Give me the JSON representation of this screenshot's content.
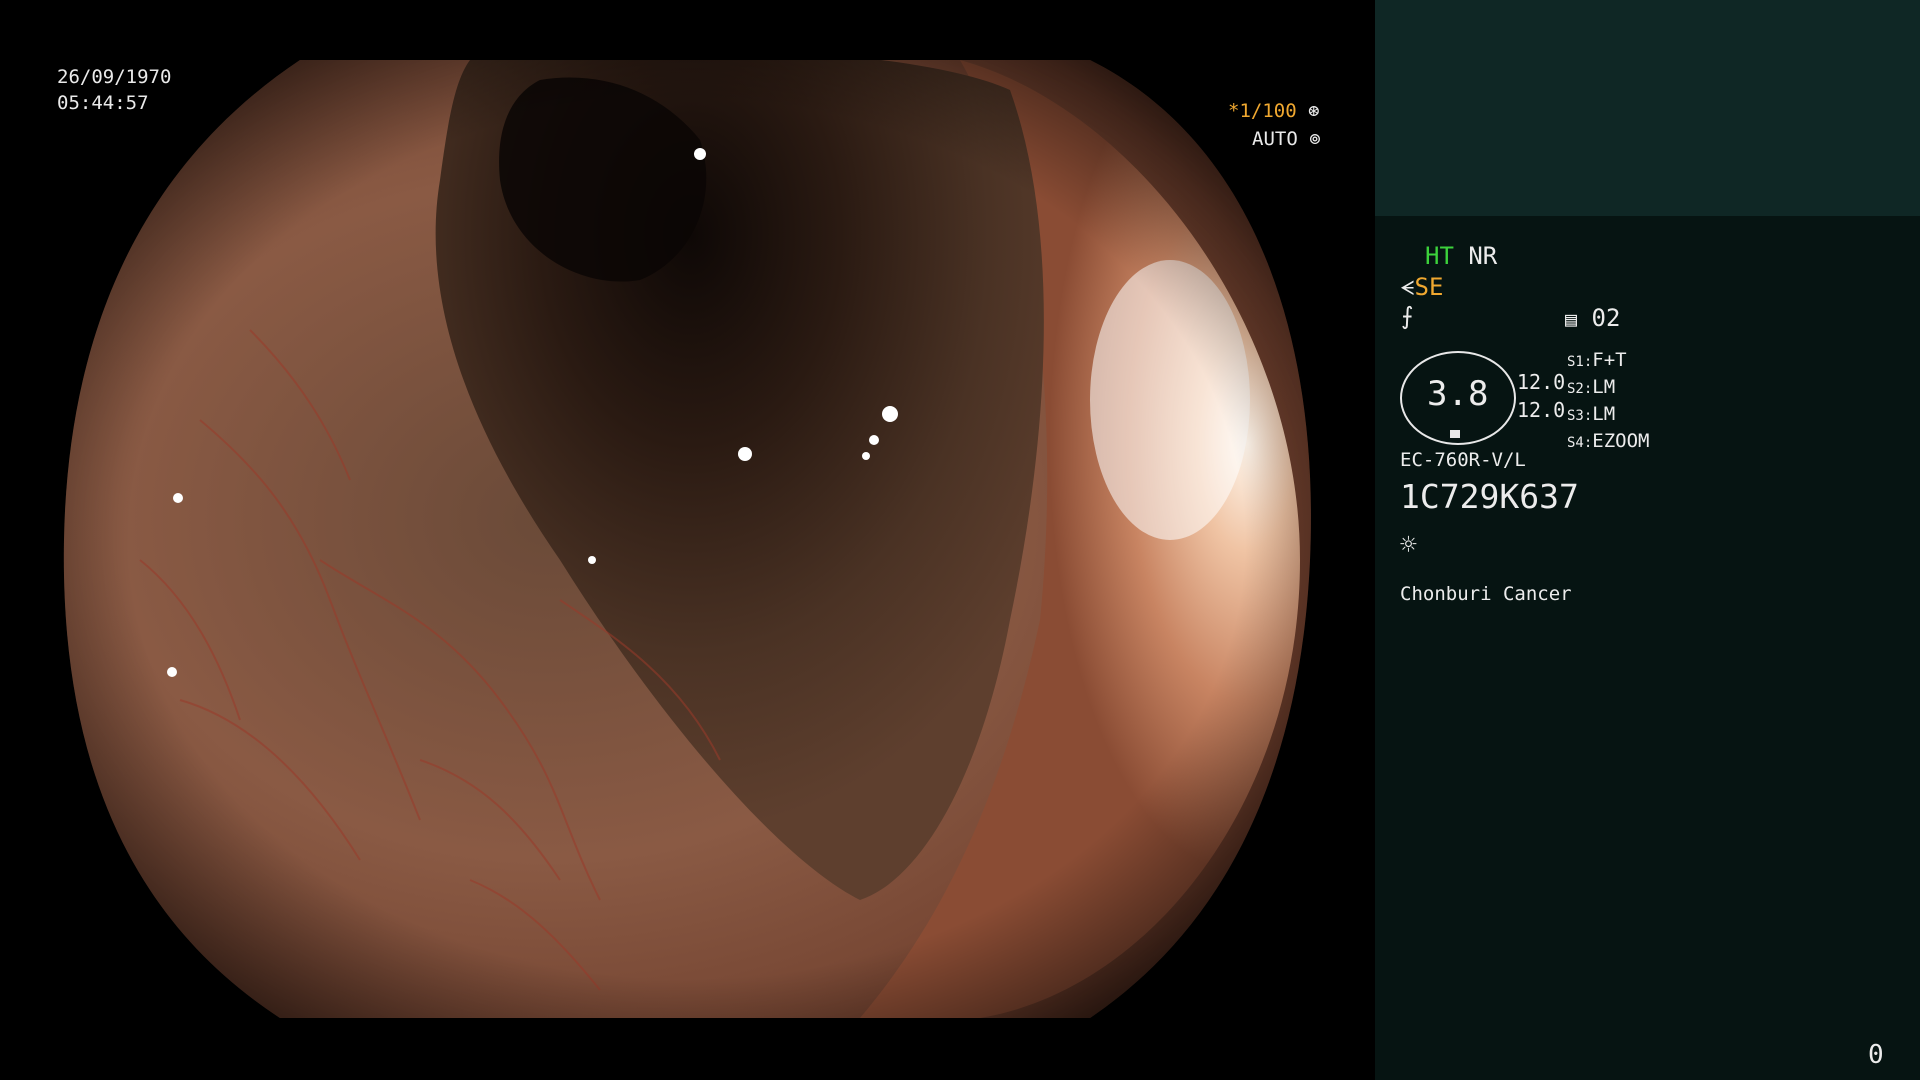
{
  "overlay": {
    "date": "26/09/1970",
    "time": "05:44:57",
    "shutter": "*1/100",
    "iris": "AUTO"
  },
  "panel": {
    "ht": "HT",
    "nr": "NR",
    "se": "SE",
    "preset": "02",
    "zoom_value": "3.8",
    "val_top": "12.0",
    "val_bottom": "12.0",
    "switches": [
      {
        "key": "S1:",
        "value": "F+T"
      },
      {
        "key": "S2:",
        "value": "LM"
      },
      {
        "key": "S3:",
        "value": "LM"
      },
      {
        "key": "S4:",
        "value": "EZOOM"
      }
    ],
    "scope_model": "EC-760R-V/L",
    "serial": "1C729K637",
    "institution": "Chonburi Cancer",
    "counter": "0"
  },
  "colors": {
    "panel_bg": "#061412",
    "panel_top_bg": "#0f2725",
    "green": "#3cd23c",
    "amber": "#f0a830"
  },
  "icons": [
    "shutter-icon",
    "iris-icon",
    "se-icon",
    "curve-icon",
    "preset-icon",
    "light-icon"
  ]
}
